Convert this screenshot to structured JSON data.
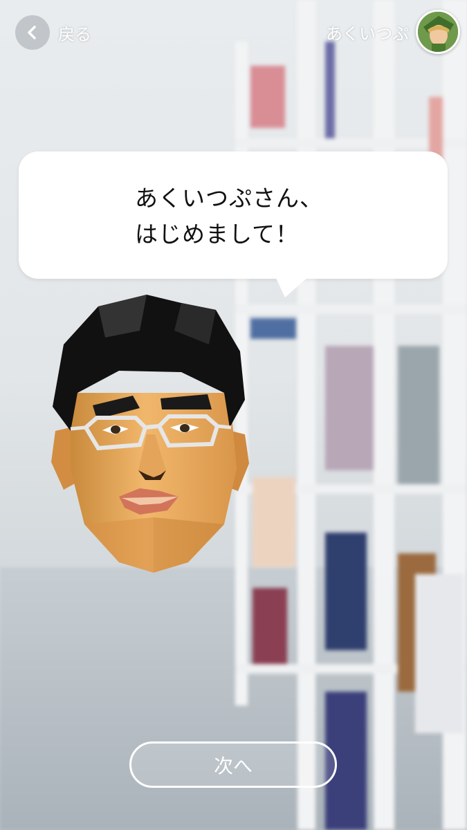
{
  "header": {
    "back_label": "戻る",
    "back_icon": "chevron-left-icon",
    "user_name": "あくいつぷ",
    "avatar_icon": "user-avatar-icon"
  },
  "dialog": {
    "line1": "あくいつぷさん、",
    "line2": "はじめまして！"
  },
  "footer": {
    "next_label": "次へ"
  },
  "colors": {
    "bubble": "#ffffff",
    "text": "#111111",
    "button_border": "#ffffff"
  }
}
